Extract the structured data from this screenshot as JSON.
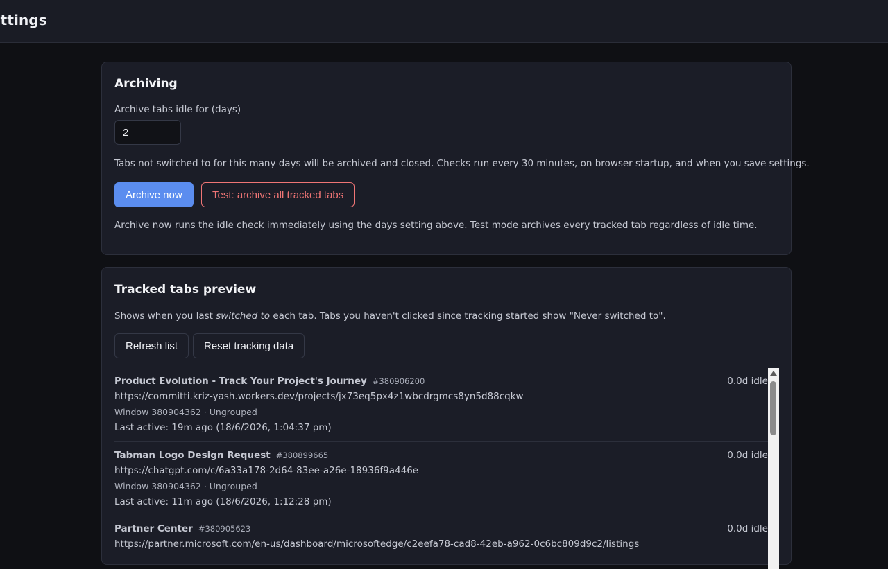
{
  "header": {
    "title": "ettings"
  },
  "archiving": {
    "heading": "Archiving",
    "days_label": "Archive tabs idle for (days)",
    "days_value": "2",
    "description": "Tabs not switched to for this many days will be archived and closed. Checks run every 30 minutes, on browser startup, and when you save settings.",
    "archive_now_label": "Archive now",
    "test_archive_label": "Test: archive all tracked tabs",
    "note": "Archive now runs the idle check immediately using the days setting above. Test mode archives every tracked tab regardless of idle time."
  },
  "tracked": {
    "heading": "Tracked tabs preview",
    "description_before": "Shows when you last ",
    "description_em": "switched to",
    "description_after": " each tab. Tabs you haven't clicked since tracking started show \"Never switched to\".",
    "refresh_label": "Refresh list",
    "reset_label": "Reset tracking data",
    "tabs": [
      {
        "title": "Product Evolution - Track Your Project's Journey",
        "id": "#380906200",
        "url": "https://committi.kriz-yash.workers.dev/projects/jx73eq5px4z1wbcdrgmcs8yn5d88cqkw",
        "window": "Window 380904362 · Ungrouped",
        "last_active": "Last active: 19m ago (18/6/2026, 1:04:37 pm)",
        "idle": "0.0d idle"
      },
      {
        "title": "Tabman Logo Design Request",
        "id": "#380899665",
        "url": "https://chatgpt.com/c/6a33a178-2d64-83ee-a26e-18936f9a446e",
        "window": "Window 380904362 · Ungrouped",
        "last_active": "Last active: 11m ago (18/6/2026, 1:12:28 pm)",
        "idle": "0.0d idle"
      },
      {
        "title": "Partner Center",
        "id": "#380905623",
        "url": "https://partner.microsoft.com/en-us/dashboard/microsoftedge/c2eefa78-cad8-42eb-a962-0c6bc809d9c2/listings",
        "window": "",
        "last_active": "",
        "idle": "0.0d idle"
      }
    ]
  }
}
